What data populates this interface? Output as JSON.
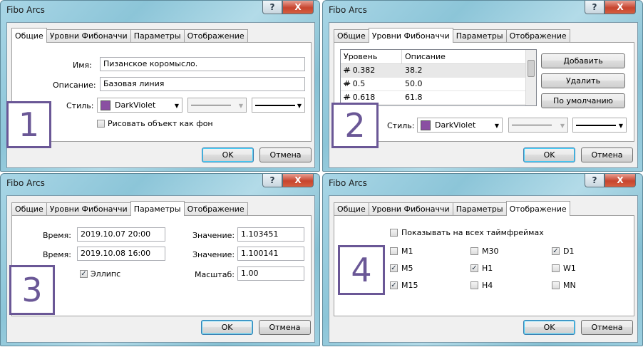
{
  "dialogs": [
    {
      "title": "Fibo Arcs",
      "tabs": [
        "Общие",
        "Уровни Фибоначчи",
        "Параметры",
        "Отображение"
      ],
      "active_tab": "Общие",
      "name_label": "Имя:",
      "name_value": "Пизанское коромысло.",
      "desc_label": "Описание:",
      "desc_value": "Базовая линия",
      "style_label": "Стиль:",
      "color_value": "DarkViolet",
      "background_checkbox": "Рисовать объект как фон",
      "ok": "OK",
      "cancel": "Отмена",
      "number": "1"
    },
    {
      "title": "Fibo Arcs",
      "tabs": [
        "Общие",
        "Уровни Фибоначчи",
        "Параметры",
        "Отображение"
      ],
      "active_tab": "Уровни Фибоначчи",
      "col_level": "Уровень",
      "col_desc": "Описание",
      "rows": [
        {
          "level": "0.382",
          "desc": "38.2"
        },
        {
          "level": "0.5",
          "desc": "50.0"
        },
        {
          "level": "0.618",
          "desc": "61.8"
        }
      ],
      "add": "Добавить",
      "delete": "Удалить",
      "default": "По умолчанию",
      "style_label": "Стиль:",
      "color_value": "DarkViolet",
      "ok": "OK",
      "cancel": "Отмена",
      "number": "2"
    },
    {
      "title": "Fibo Arcs",
      "tabs": [
        "Общие",
        "Уровни Фибоначчи",
        "Параметры",
        "Отображение"
      ],
      "active_tab": "Параметры",
      "time_label": "Время:",
      "time1": "2019.10.07 20:00",
      "time2": "2019.10.08 16:00",
      "value_label": "Значение:",
      "value1": "1.103451",
      "value2": "1.100141",
      "ellipse": "Эллипс",
      "scale_label": "Масштаб:",
      "scale": "1.00",
      "ok": "OK",
      "cancel": "Отмена",
      "number": "3"
    },
    {
      "title": "Fibo Arcs",
      "tabs": [
        "Общие",
        "Уровни Фибоначчи",
        "Параметры",
        "Отображение"
      ],
      "active_tab": "Отображение",
      "all_timeframes": "Показывать на всех таймфреймах",
      "timeframes": [
        {
          "label": "M1",
          "checked": false
        },
        {
          "label": "M30",
          "checked": false
        },
        {
          "label": "D1",
          "checked": true
        },
        {
          "label": "M5",
          "checked": true
        },
        {
          "label": "H1",
          "checked": true
        },
        {
          "label": "W1",
          "checked": false
        },
        {
          "label": "M15",
          "checked": true
        },
        {
          "label": "H4",
          "checked": false
        },
        {
          "label": "MN",
          "checked": false
        }
      ],
      "ok": "OK",
      "cancel": "Отмена",
      "number": "4"
    }
  ],
  "icons": {
    "help": "?",
    "close": "X",
    "check": "✓",
    "hash_icon": "#"
  }
}
